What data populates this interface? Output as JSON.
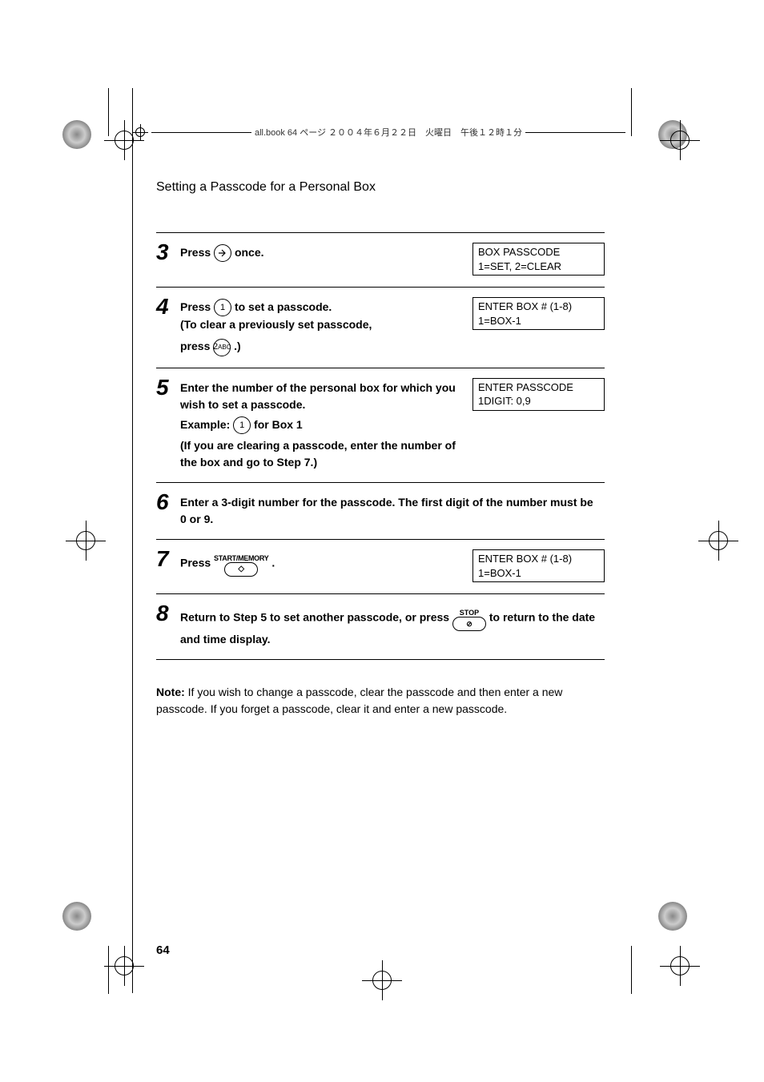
{
  "header": {
    "strip": "all.book  64 ページ  ２００４年６月２２日　火曜日　午後１２時１分"
  },
  "title": "Setting a Passcode for a Personal Box",
  "steps": {
    "s3": {
      "num": "3",
      "text_a": "Press",
      "text_b": " once.",
      "display_l1": "BOX PASSCODE",
      "display_l2": "1=SET, 2=CLEAR"
    },
    "s4": {
      "num": "4",
      "text_a": "Press ",
      "key1": "1",
      "text_b": " to set a passcode.",
      "text_c": "(To clear a previously set passcode,",
      "text_d": "press ",
      "key2_main": "2",
      "key2_sub": "ABC",
      "text_e": " .)",
      "display_l1": "ENTER BOX # (1-8)",
      "display_l2": "1=BOX-1"
    },
    "s5": {
      "num": "5",
      "text_a": "Enter the number of the personal box for which you wish to set a passcode.",
      "text_b": "Example: ",
      "key1": "1",
      "text_c": " for Box 1",
      "text_d": "(If you are clearing a passcode, enter the number of the box and go to Step 7.)",
      "display_l1": "ENTER PASSCODE",
      "display_l2": "1DIGIT: 0,9"
    },
    "s6": {
      "num": "6",
      "text": "Enter a 3-digit number for the passcode. The first digit of the number must be 0 or 9."
    },
    "s7": {
      "num": "7",
      "text_a": "Press ",
      "key_label": "START/MEMORY",
      "text_b": " .",
      "display_l1": "ENTER BOX # (1-8)",
      "display_l2": "1=BOX-1"
    },
    "s8": {
      "num": "8",
      "text_a": "Return to Step 5 to set another passcode, or press ",
      "key_label": "STOP",
      "text_b": " to return to the date and time display."
    }
  },
  "note": {
    "label": "Note:",
    "text": " If you wish to change a passcode, clear the passcode and then enter a new passcode. If you forget a passcode, clear it and enter a new passcode."
  },
  "page_number": "64"
}
